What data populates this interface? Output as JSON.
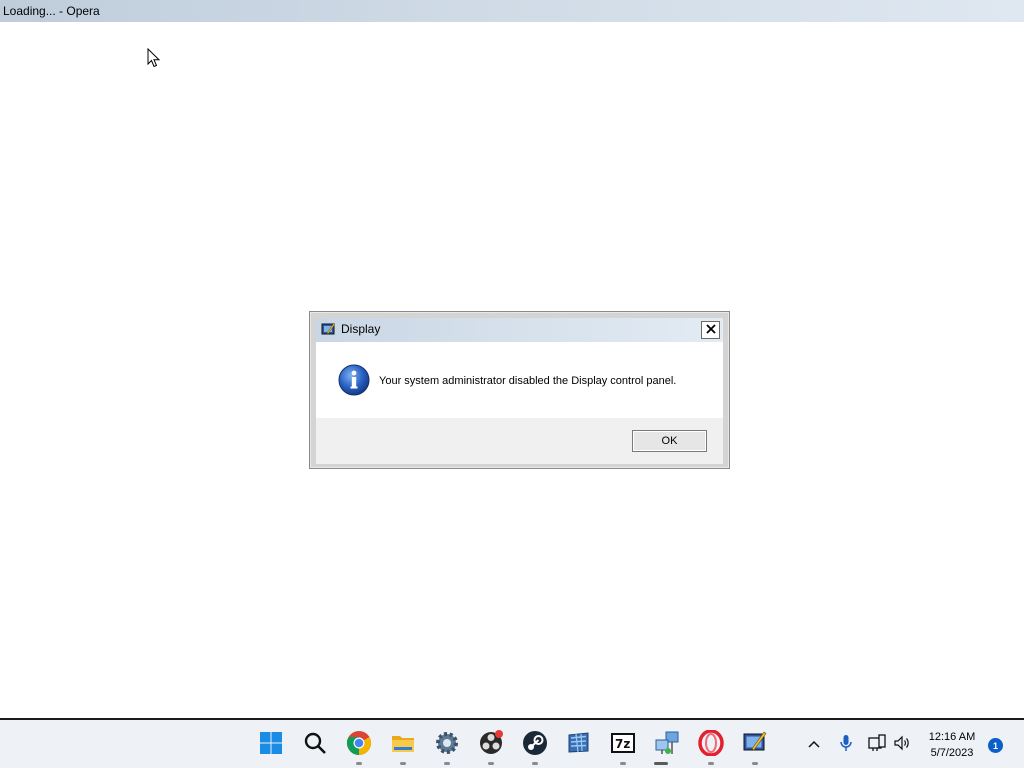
{
  "window": {
    "title": "Loading... - Opera"
  },
  "dialog": {
    "title": "Display",
    "message": "Your system administrator disabled the Display control panel.",
    "ok_label": "OK",
    "close_icon": "close-icon",
    "message_icon": "info-icon"
  },
  "taskbar": {
    "items": [
      {
        "name": "start-button",
        "icon": "windows-logo-icon"
      },
      {
        "name": "search-button",
        "icon": "search-icon"
      },
      {
        "name": "chrome",
        "icon": "chrome-icon"
      },
      {
        "name": "file-explorer",
        "icon": "folder-icon"
      },
      {
        "name": "settings",
        "icon": "gear-icon"
      },
      {
        "name": "obs",
        "icon": "obs-icon"
      },
      {
        "name": "steam",
        "icon": "steam-icon"
      },
      {
        "name": "control-panel",
        "icon": "control-panel-icon"
      },
      {
        "name": "7zip",
        "icon": "7zip-icon"
      },
      {
        "name": "network-app",
        "icon": "network-icon"
      },
      {
        "name": "opera",
        "icon": "opera-icon"
      },
      {
        "name": "display",
        "icon": "display-icon"
      }
    ],
    "tray": {
      "chevron_icon": "chevron-up-icon",
      "mic_icon": "microphone-icon",
      "network_icon": "network-status-icon",
      "volume_icon": "volume-icon"
    },
    "clock": {
      "time": "12:16 AM",
      "date": "5/7/2023"
    },
    "notification_count": "1"
  },
  "colors": {
    "accent": "#0a5fc8",
    "titlebar": "#cfdae6",
    "taskbar": "#eef2f6"
  }
}
